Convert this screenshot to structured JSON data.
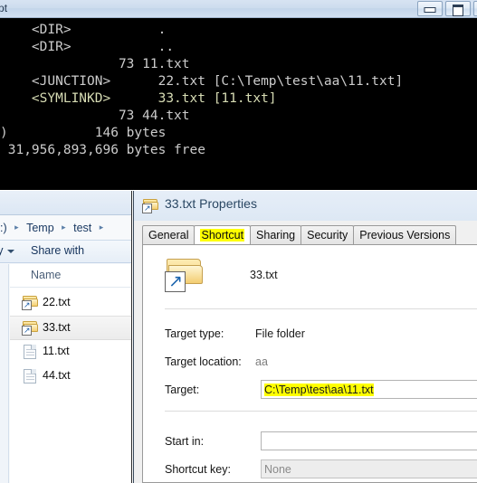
{
  "console": {
    "title": "pt",
    "window_buttons": [
      {
        "name": "minimize-button",
        "glyph": "minimize-icon"
      },
      {
        "name": "maximize-button",
        "glyph": "maximize-icon"
      },
      {
        "name": "close-button",
        "glyph": "×"
      }
    ],
    "lines": [
      {
        "text": "    <DIR>           .",
        "style": "normal"
      },
      {
        "text": "    <DIR>           ..",
        "style": "normal"
      },
      {
        "text": "               73 11.txt",
        "style": "normal"
      },
      {
        "text": "    <JUNCTION>      22.txt [C:\\Temp\\test\\aa\\11.txt]",
        "style": "normal"
      },
      {
        "text": "    <SYMLINKD>      33.txt [11.txt]",
        "style": "symlink"
      },
      {
        "text": "               73 44.txt",
        "style": "normal"
      },
      {
        "text": ")           146 bytes",
        "style": "normal"
      },
      {
        "text": " 31,956,893,696 bytes free",
        "style": "normal"
      }
    ],
    "colors": {
      "background": "#000000",
      "foreground": "#cccccc",
      "symlink": "#d7dcb4"
    }
  },
  "explorer": {
    "breadcrumb": {
      "crumbs": [
        ":)",
        "Temp",
        "test"
      ],
      "separator": "▸",
      "trailing_separator": "▸"
    },
    "toolbar": {
      "organize_label": "rary",
      "share_label": "Share with"
    },
    "column_header": "Name",
    "files": [
      {
        "name": "22.txt",
        "icon": "folder-shortcut-icon",
        "selected": false
      },
      {
        "name": "33.txt",
        "icon": "folder-shortcut-icon",
        "selected": true
      },
      {
        "name": "11.txt",
        "icon": "text-document-icon",
        "selected": false
      },
      {
        "name": "44.txt",
        "icon": "text-document-icon",
        "selected": false
      }
    ]
  },
  "properties_dialog": {
    "title": "33.txt Properties",
    "title_icon": "folder-shortcut-icon",
    "tabs": [
      {
        "label": "General",
        "active": false,
        "highlighted": false
      },
      {
        "label": "Shortcut",
        "active": true,
        "highlighted": true
      },
      {
        "label": "Sharing",
        "active": false,
        "highlighted": false
      },
      {
        "label": "Security",
        "active": false,
        "highlighted": false
      },
      {
        "label": "Previous Versions",
        "active": false,
        "highlighted": false
      }
    ],
    "shortcut_name": "33.txt",
    "fields": {
      "target_type_label": "Target type:",
      "target_type_value": "File folder",
      "target_location_label": "Target location:",
      "target_location_value": "aa",
      "target_label": "Target:",
      "target_value": "C:\\Temp\\test\\aa\\11.txt",
      "start_in_label": "Start in:",
      "start_in_value": "",
      "shortcut_key_label": "Shortcut key:",
      "shortcut_key_value": "None"
    },
    "highlight_color": "#ffff00"
  }
}
